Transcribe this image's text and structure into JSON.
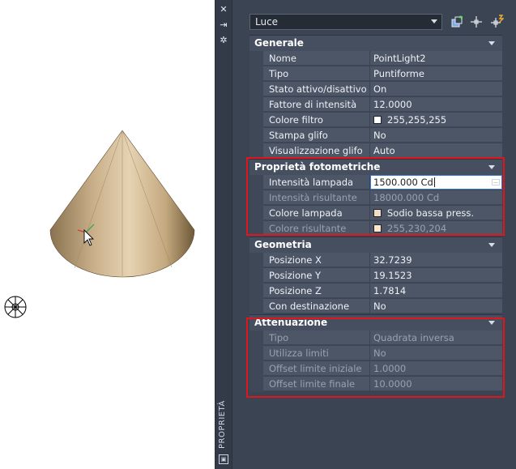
{
  "palette": {
    "title": "PROPRIETÀ",
    "object_type": "Luce",
    "sections": [
      {
        "title": "Generale",
        "rows": [
          {
            "name": "Nome",
            "value": "PointLight2"
          },
          {
            "name": "Tipo",
            "value": "Puntiforme"
          },
          {
            "name": "Stato attivo/disattivo",
            "value": "On"
          },
          {
            "name": "Fattore di intensità",
            "value": "12.0000"
          },
          {
            "name": "Colore filtro",
            "value": "255,255,255",
            "swatch": "#ffffff"
          },
          {
            "name": "Stampa glifo",
            "value": "No"
          },
          {
            "name": "Visualizzazione glifo",
            "value": "Auto"
          }
        ]
      },
      {
        "title": "Proprietà fotometriche",
        "rows": [
          {
            "name": "Intensità lampada",
            "value": "1500.000 Cd",
            "editing": true
          },
          {
            "name": "Intensità risultante",
            "value": "18000.000 Cd",
            "readonly": true
          },
          {
            "name": "Colore lampada",
            "value": "Sodio bassa press.",
            "swatch": "#f2dcc6"
          },
          {
            "name": "Colore risultante",
            "value": "255,230,204",
            "swatch": "#ffe6cc",
            "readonly": true
          }
        ]
      },
      {
        "title": "Geometria",
        "rows": [
          {
            "name": "Posizione X",
            "value": "32.7239"
          },
          {
            "name": "Posizione Y",
            "value": "19.1523"
          },
          {
            "name": "Posizione Z",
            "value": "1.7814"
          },
          {
            "name": "Con destinazione",
            "value": "No"
          }
        ]
      },
      {
        "title": "Attenuazione",
        "rows": [
          {
            "name": "Tipo",
            "value": "Quadrata inversa",
            "readonly": true
          },
          {
            "name": "Utilizza limiti",
            "value": "No",
            "readonly": true
          },
          {
            "name": "Offset limite iniziale",
            "value": "1.0000",
            "readonly": true
          },
          {
            "name": "Offset limite finale",
            "value": "10.0000",
            "readonly": true
          }
        ]
      }
    ]
  },
  "colors": {
    "highlight": "#e2141c",
    "cone_light": "#e6d2b2",
    "cone_dark": "#6e5838"
  },
  "icons": [
    "close-icon",
    "autohide-icon",
    "settings-icon",
    "quick-select-icon",
    "select-objects-icon",
    "toggle-pickadd-icon",
    "light-glyph-icon",
    "ucs-cursor-icon"
  ]
}
